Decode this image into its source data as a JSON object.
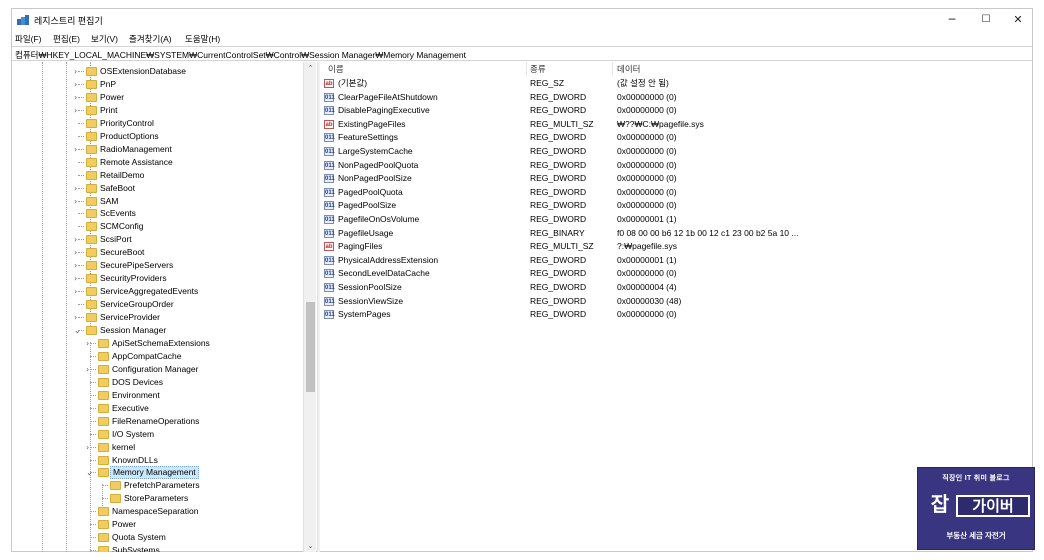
{
  "window": {
    "title": "레지스트리 편집기",
    "min_label": "─",
    "max_label": "☐",
    "close_label": "✕"
  },
  "menu": [
    {
      "label": "파일(F)"
    },
    {
      "label": "편집(E)"
    },
    {
      "label": "보기(V)"
    },
    {
      "label": "즐겨찾기(A)"
    },
    {
      "label": "도움말(H)"
    }
  ],
  "address": {
    "path": "컴퓨터₩HKEY_LOCAL_MACHINE₩SYSTEM₩CurrentControlSet₩Control₩Session Manager₩Memory Management"
  },
  "tree": {
    "items": [
      {
        "label": "OSExtensionDatabase",
        "expander": ">"
      },
      {
        "label": "PnP",
        "expander": ">"
      },
      {
        "label": "Power",
        "expander": ">"
      },
      {
        "label": "Print",
        "expander": ">"
      },
      {
        "label": "PriorityControl",
        "expander": ""
      },
      {
        "label": "ProductOptions",
        "expander": ""
      },
      {
        "label": "RadioManagement",
        "expander": ">"
      },
      {
        "label": "Remote Assistance",
        "expander": ""
      },
      {
        "label": "RetailDemo",
        "expander": ""
      },
      {
        "label": "SafeBoot",
        "expander": ">"
      },
      {
        "label": "SAM",
        "expander": ">"
      },
      {
        "label": "ScEvents",
        "expander": ""
      },
      {
        "label": "SCMConfig",
        "expander": ""
      },
      {
        "label": "ScsiPort",
        "expander": ">"
      },
      {
        "label": "SecureBoot",
        "expander": ">"
      },
      {
        "label": "SecurePipeServers",
        "expander": ">"
      },
      {
        "label": "SecurityProviders",
        "expander": ">"
      },
      {
        "label": "ServiceAggregatedEvents",
        "expander": ">"
      },
      {
        "label": "ServiceGroupOrder",
        "expander": ""
      },
      {
        "label": "ServiceProvider",
        "expander": ">"
      },
      {
        "label": "Session Manager",
        "expander": "v"
      },
      {
        "label": "ApiSetSchemaExtensions",
        "expander": ">"
      },
      {
        "label": "AppCompatCache",
        "expander": ""
      },
      {
        "label": "Configuration Manager",
        "expander": ">"
      },
      {
        "label": "DOS Devices",
        "expander": ""
      },
      {
        "label": "Environment",
        "expander": ""
      },
      {
        "label": "Executive",
        "expander": ""
      },
      {
        "label": "FileRenameOperations",
        "expander": ""
      },
      {
        "label": "I/O System",
        "expander": ""
      },
      {
        "label": "kernel",
        "expander": ">"
      },
      {
        "label": "KnownDLLs",
        "expander": ""
      },
      {
        "label": "Memory Management",
        "expander": "v",
        "selected": true
      },
      {
        "label": "PrefetchParameters",
        "expander": ""
      },
      {
        "label": "StoreParameters",
        "expander": ""
      },
      {
        "label": "NamespaceSeparation",
        "expander": ""
      },
      {
        "label": "Power",
        "expander": ""
      },
      {
        "label": "Quota System",
        "expander": ""
      },
      {
        "label": "SubSystems",
        "expander": ""
      }
    ],
    "scroll_up": "⌃",
    "scroll_down": "⌄"
  },
  "list": {
    "headers": {
      "name": "이름",
      "type": "종류",
      "data": "데이터"
    },
    "rows": [
      {
        "icon": "ab",
        "name": "(기본값)",
        "type": "REG_SZ",
        "data": "(값 설정 안 됨)"
      },
      {
        "icon": "bin",
        "name": "ClearPageFileAtShutdown",
        "type": "REG_DWORD",
        "data": "0x00000000 (0)"
      },
      {
        "icon": "bin",
        "name": "DisablePagingExecutive",
        "type": "REG_DWORD",
        "data": "0x00000000 (0)"
      },
      {
        "icon": "ab",
        "name": "ExistingPageFiles",
        "type": "REG_MULTI_SZ",
        "data": "₩??₩C:₩pagefile.sys"
      },
      {
        "icon": "bin",
        "name": "FeatureSettings",
        "type": "REG_DWORD",
        "data": "0x00000000 (0)"
      },
      {
        "icon": "bin",
        "name": "LargeSystemCache",
        "type": "REG_DWORD",
        "data": "0x00000000 (0)"
      },
      {
        "icon": "bin",
        "name": "NonPagedPoolQuota",
        "type": "REG_DWORD",
        "data": "0x00000000 (0)"
      },
      {
        "icon": "bin",
        "name": "NonPagedPoolSize",
        "type": "REG_DWORD",
        "data": "0x00000000 (0)"
      },
      {
        "icon": "bin",
        "name": "PagedPoolQuota",
        "type": "REG_DWORD",
        "data": "0x00000000 (0)"
      },
      {
        "icon": "bin",
        "name": "PagedPoolSize",
        "type": "REG_DWORD",
        "data": "0x00000000 (0)"
      },
      {
        "icon": "bin",
        "name": "PagefileOnOsVolume",
        "type": "REG_DWORD",
        "data": "0x00000001 (1)"
      },
      {
        "icon": "bin",
        "name": "PagefileUsage",
        "type": "REG_BINARY",
        "data": "f0 08 00 00 b6 12 1b 00 12 c1 23 00 b2 5a 10 ..."
      },
      {
        "icon": "ab",
        "name": "PagingFiles",
        "type": "REG_MULTI_SZ",
        "data": "?:₩pagefile.sys"
      },
      {
        "icon": "bin",
        "name": "PhysicalAddressExtension",
        "type": "REG_DWORD",
        "data": "0x00000001 (1)"
      },
      {
        "icon": "bin",
        "name": "SecondLevelDataCache",
        "type": "REG_DWORD",
        "data": "0x00000000 (0)"
      },
      {
        "icon": "bin",
        "name": "SessionPoolSize",
        "type": "REG_DWORD",
        "data": "0x00000004 (4)"
      },
      {
        "icon": "bin",
        "name": "SessionViewSize",
        "type": "REG_DWORD",
        "data": "0x00000030 (48)"
      },
      {
        "icon": "bin",
        "name": "SystemPages",
        "type": "REG_DWORD",
        "data": "0x00000000 (0)"
      }
    ]
  },
  "watermark": {
    "top": "직장인 IT 취미 블로그",
    "logo_char": "잡",
    "main": "가이버",
    "bottom": "부동산 세금 자전거"
  },
  "colors": {
    "selection": "#cce8ff",
    "folder": "#f0cd62",
    "watermark_bg": "#3a3580"
  }
}
